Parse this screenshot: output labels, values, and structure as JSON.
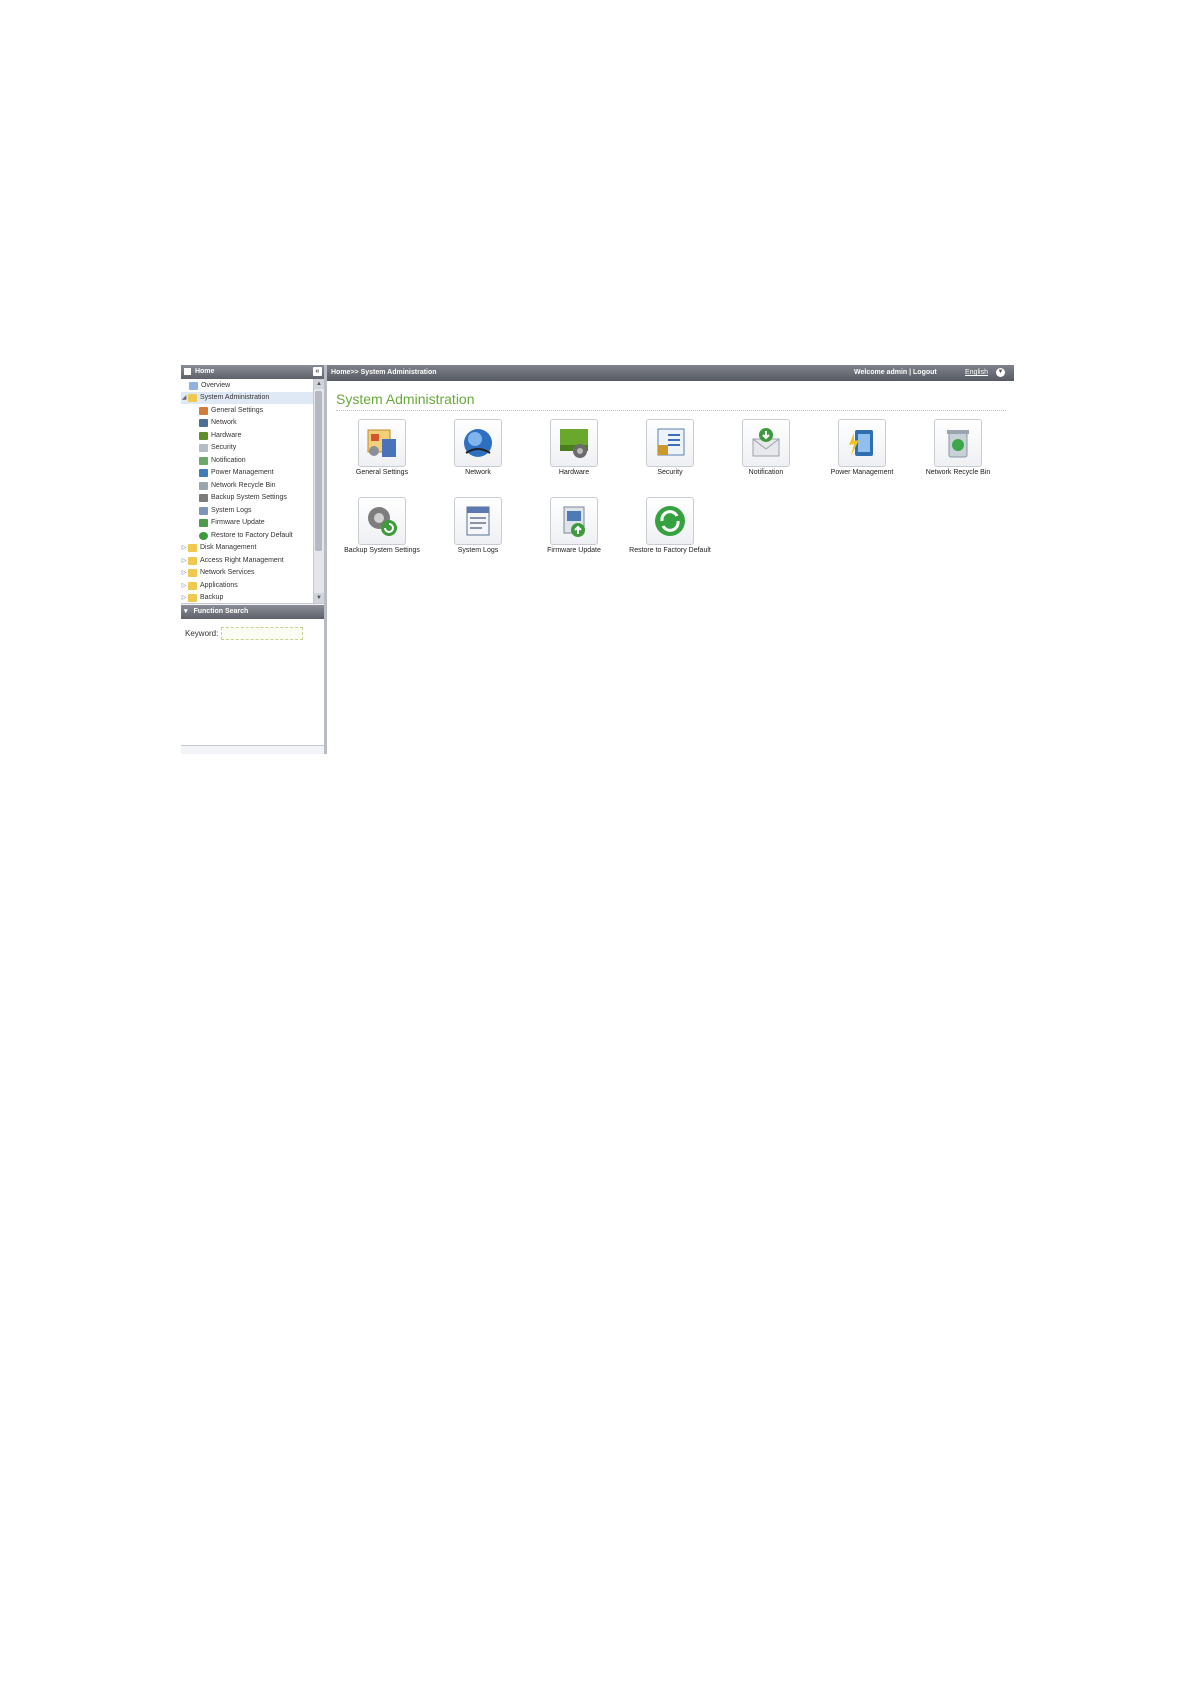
{
  "sidebar": {
    "header": "Home",
    "collapse_glyph": "«",
    "tree": [
      {
        "label": "Overview",
        "icon": "overview-icon"
      },
      {
        "label": "System Administration",
        "icon": "folder-icon"
      },
      {
        "label": "General Settings",
        "icon": "general-settings-icon"
      },
      {
        "label": "Network",
        "icon": "network-icon"
      },
      {
        "label": "Hardware",
        "icon": "hardware-icon"
      },
      {
        "label": "Security",
        "icon": "security-icon"
      },
      {
        "label": "Notification",
        "icon": "notification-icon"
      },
      {
        "label": "Power Management",
        "icon": "power-icon"
      },
      {
        "label": "Network Recycle Bin",
        "icon": "recycle-bin-icon"
      },
      {
        "label": "Backup System Settings",
        "icon": "backup-icon"
      },
      {
        "label": "System Logs",
        "icon": "logs-icon"
      },
      {
        "label": "Firmware Update",
        "icon": "firmware-icon"
      },
      {
        "label": "Restore to Factory Default",
        "icon": "restore-icon"
      },
      {
        "label": "Disk Management",
        "icon": "folder-icon"
      },
      {
        "label": "Access Right Management",
        "icon": "folder-icon"
      },
      {
        "label": "Network Services",
        "icon": "folder-icon"
      },
      {
        "label": "Applications",
        "icon": "folder-icon"
      },
      {
        "label": "Backup",
        "icon": "folder-icon"
      }
    ]
  },
  "search": {
    "header": "Function Search",
    "keyword_label": "Keyword:",
    "keyword_value": ""
  },
  "topbar": {
    "breadcrumb": "Home>> System Administration",
    "welcome": "Welcome admin | Logout",
    "language": "English"
  },
  "main": {
    "title": "System Administration",
    "tiles": [
      {
        "label": "General Settings",
        "icon": "general-settings-icon"
      },
      {
        "label": "Network",
        "icon": "network-icon"
      },
      {
        "label": "Hardware",
        "icon": "hardware-icon"
      },
      {
        "label": "Security",
        "icon": "security-icon"
      },
      {
        "label": "Notification",
        "icon": "notification-icon"
      },
      {
        "label": "Power Management",
        "icon": "power-icon"
      },
      {
        "label": "Network Recycle Bin",
        "icon": "recycle-bin-icon"
      },
      {
        "label": "Backup System Settings",
        "icon": "backup-icon"
      },
      {
        "label": "System Logs",
        "icon": "logs-icon"
      },
      {
        "label": "Firmware Update",
        "icon": "firmware-icon"
      },
      {
        "label": "Restore to Factory Default",
        "icon": "restore-icon"
      }
    ]
  },
  "colors": {
    "title_green": "#6aa83a",
    "bar_gray": "#5e616a"
  }
}
